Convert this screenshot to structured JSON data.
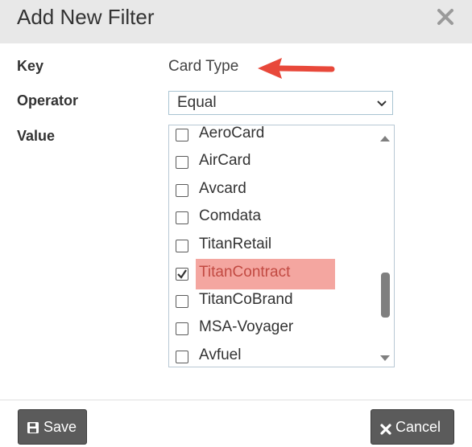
{
  "dialog": {
    "title": "Add New Filter",
    "close_label": "close"
  },
  "form": {
    "key_label": "Key",
    "key_value": "Card Type",
    "operator_label": "Operator",
    "operator_value": "Equal",
    "value_label": "Value"
  },
  "list": {
    "items": [
      {
        "label": "AeroCard",
        "checked": false
      },
      {
        "label": "AirCard",
        "checked": false
      },
      {
        "label": "Avcard",
        "checked": false
      },
      {
        "label": "Comdata",
        "checked": false
      },
      {
        "label": "TitanRetail",
        "checked": false
      },
      {
        "label": "TitanContract",
        "checked": true,
        "highlighted": true
      },
      {
        "label": "TitanCoBrand",
        "checked": false
      },
      {
        "label": "MSA-Voyager",
        "checked": false
      },
      {
        "label": "Avfuel",
        "checked": false
      }
    ]
  },
  "footer": {
    "save_label": "Save",
    "cancel_label": "Cancel"
  },
  "colors": {
    "header_bg": "#e8e8e8",
    "button_bg": "#5b5b5b",
    "highlight": "#f4a6a0",
    "annotation_arrow": "#e8483a"
  }
}
